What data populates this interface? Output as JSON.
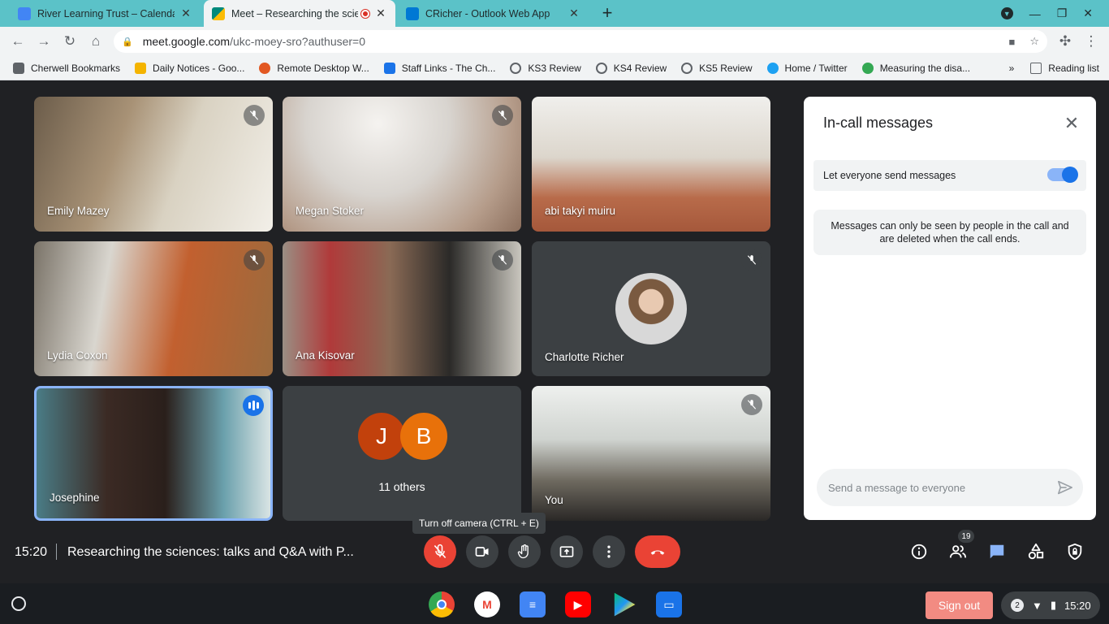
{
  "browser": {
    "tabs": [
      {
        "title": "River Learning Trust – Calendar",
        "favicon_color": "#4285f4"
      },
      {
        "title": "Meet – Researching the scie",
        "favicon_color": "#00897b"
      },
      {
        "title": "CRicher - Outlook Web App",
        "favicon_color": "#0078d4"
      }
    ],
    "url_host": "meet.google.com",
    "url_path": "/ukc-moey-sro?authuser=0",
    "bookmarks": [
      {
        "label": "Cherwell Bookmarks",
        "color": "#5f6368"
      },
      {
        "label": "Daily Notices - Goo...",
        "color": "#f4b400"
      },
      {
        "label": "Remote Desktop W...",
        "color": "#e25822"
      },
      {
        "label": "Staff Links - The Ch...",
        "color": "#1a73e8"
      },
      {
        "label": "KS3 Review",
        "color": "#5f6368"
      },
      {
        "label": "KS4 Review",
        "color": "#5f6368"
      },
      {
        "label": "KS5 Review",
        "color": "#5f6368"
      },
      {
        "label": "Home / Twitter",
        "color": "#1da1f2"
      },
      {
        "label": "Measuring the disa...",
        "color": "#34a853"
      }
    ],
    "more_label": "»",
    "reading_list": "Reading list"
  },
  "meet": {
    "participants": [
      {
        "name": "Emily Mazey"
      },
      {
        "name": "Megan Stoker"
      },
      {
        "name": "abi takyi muiru"
      },
      {
        "name": "Lydia Coxon"
      },
      {
        "name": "Ana Kisovar"
      },
      {
        "name": "Charlotte Richer"
      },
      {
        "name": "Josephine"
      },
      {
        "name": "You"
      }
    ],
    "others": {
      "initials": [
        "J",
        "B"
      ],
      "label": "11 others"
    },
    "tooltip": "Turn off camera (CTRL + E)",
    "time": "15:20",
    "title": "Researching the sciences: talks and Q&A with P...",
    "people_count": "19",
    "panel": {
      "title": "In-call messages",
      "toggle_label": "Let everyone send messages",
      "toggle_on": true,
      "notice": "Messages can only be seen by people in the call and are deleted when the call ends.",
      "input_placeholder": "Send a message to everyone"
    }
  },
  "shelf": {
    "sign_out": "Sign out",
    "notifications": "2",
    "time": "15:20"
  },
  "colors": {
    "accent": "#1a73e8",
    "end_call": "#ea4335",
    "tab_strip": "#5bc2c8",
    "meet_bg": "#202124"
  }
}
